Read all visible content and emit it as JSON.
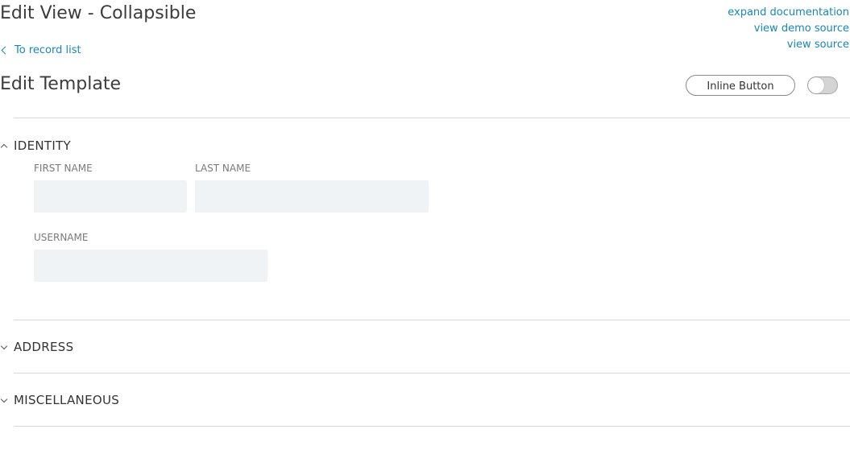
{
  "header": {
    "title": "Edit View - Collapsible",
    "links": [
      {
        "label": "expand documentation"
      },
      {
        "label": "view demo source"
      },
      {
        "label": "view source"
      }
    ],
    "back_link": "To record list"
  },
  "edit_section": {
    "title": "Edit Template",
    "inline_button_label": "Inline Button",
    "toggle_on": false
  },
  "groups": {
    "identity": {
      "label": "IDENTITY",
      "expanded": true,
      "fields": {
        "first_name": {
          "label": "FIRST NAME",
          "value": ""
        },
        "last_name": {
          "label": "LAST NAME",
          "value": ""
        },
        "username": {
          "label": "USERNAME",
          "value": ""
        }
      }
    },
    "address": {
      "label": "ADDRESS",
      "expanded": false
    },
    "miscellaneous": {
      "label": "MISCELLANEOUS",
      "expanded": false
    }
  },
  "colors": {
    "link": "#1a85b8",
    "input_bg": "#eff3f6",
    "divider": "#d8d8d8",
    "text": "#333333",
    "label": "#7a7a7a"
  }
}
